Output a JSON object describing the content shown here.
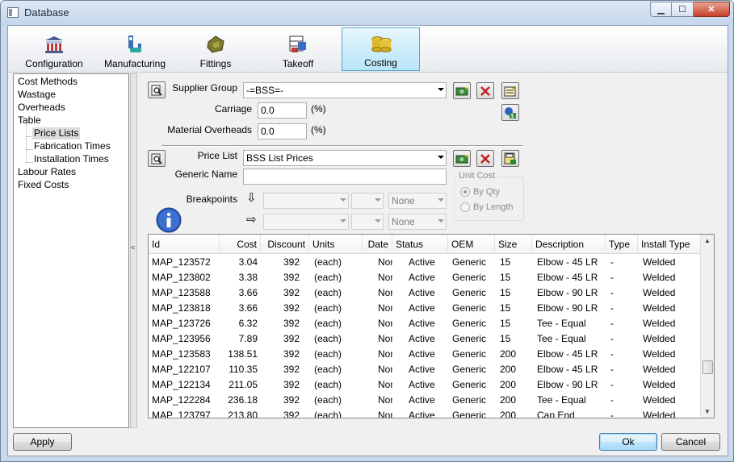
{
  "window": {
    "title": "Database"
  },
  "ribbon": {
    "tabs": [
      {
        "label": "Configuration",
        "icon": "configuration-icon"
      },
      {
        "label": "Manufacturing",
        "icon": "manufacturing-icon"
      },
      {
        "label": "Fittings",
        "icon": "fittings-icon"
      },
      {
        "label": "Takeoff",
        "icon": "takeoff-icon"
      },
      {
        "label": "Costing",
        "icon": "costing-icon",
        "active": true
      }
    ]
  },
  "tree": {
    "items": [
      {
        "label": "Cost Methods"
      },
      {
        "label": "Wastage"
      },
      {
        "label": "Overheads"
      },
      {
        "label": "Table"
      },
      {
        "label": "Price Lists",
        "selected": true
      },
      {
        "label": "Fabrication Times"
      },
      {
        "label": "Installation Times"
      },
      {
        "label": "Labour Rates"
      },
      {
        "label": "Fixed Costs"
      }
    ]
  },
  "supplier": {
    "group_label": "Supplier Group",
    "group_value": "-=BSS=-",
    "carriage_label": "Carriage",
    "carriage_value": "0.0",
    "carriage_unit": "(%)",
    "material_overheads_label": "Material Overheads",
    "material_overheads_value": "0.0",
    "material_overheads_unit": "(%)"
  },
  "pricelist": {
    "label": "Price List",
    "value": "BSS List Prices",
    "generic_name_label": "Generic Name",
    "generic_name_value": "",
    "breakpoints_label": "Breakpoints",
    "bp_none_1": "None",
    "bp_none_2": "None"
  },
  "unit_cost": {
    "title": "Unit Cost",
    "by_qty": "By Qty",
    "by_length": "By Length",
    "selected": "By Qty"
  },
  "table": {
    "columns": [
      "Id",
      "Cost",
      "Discount",
      "Units",
      "Date",
      "Status",
      "OEM",
      "Size",
      "Description",
      "Type",
      "Install Type"
    ],
    "rows": [
      [
        "MAP_123572",
        "3.04",
        "392",
        "(each)",
        "None",
        "Active",
        "Generic",
        "15",
        "Elbow - 45 LR",
        "-",
        "Welded"
      ],
      [
        "MAP_123802",
        "3.38",
        "392",
        "(each)",
        "None",
        "Active",
        "Generic",
        "15",
        "Elbow - 45 LR",
        "-",
        "Welded"
      ],
      [
        "MAP_123588",
        "3.66",
        "392",
        "(each)",
        "None",
        "Active",
        "Generic",
        "15",
        "Elbow - 90 LR",
        "-",
        "Welded"
      ],
      [
        "MAP_123818",
        "3.66",
        "392",
        "(each)",
        "None",
        "Active",
        "Generic",
        "15",
        "Elbow - 90 LR",
        "-",
        "Welded"
      ],
      [
        "MAP_123726",
        "6.32",
        "392",
        "(each)",
        "None",
        "Active",
        "Generic",
        "15",
        "Tee - Equal",
        "-",
        "Welded"
      ],
      [
        "MAP_123956",
        "7.89",
        "392",
        "(each)",
        "None",
        "Active",
        "Generic",
        "15",
        "Tee - Equal",
        "-",
        "Welded"
      ],
      [
        "MAP_123583",
        "138.51",
        "392",
        "(each)",
        "None",
        "Active",
        "Generic",
        "200",
        "Elbow - 45 LR",
        "-",
        "Welded"
      ],
      [
        "MAP_122107",
        "110.35",
        "392",
        "(each)",
        "None",
        "Active",
        "Generic",
        "200",
        "Elbow - 45 LR",
        "-",
        "Welded"
      ],
      [
        "MAP_122134",
        "211.05",
        "392",
        "(each)",
        "None",
        "Active",
        "Generic",
        "200",
        "Elbow - 90 LR",
        "-",
        "Welded"
      ],
      [
        "MAP_122284",
        "236.18",
        "392",
        "(each)",
        "None",
        "Active",
        "Generic",
        "200",
        "Tee - Equal",
        "-",
        "Welded"
      ],
      [
        "MAP_123797",
        "213.80",
        "392",
        "(each)",
        "None",
        "Active",
        "Generic",
        "200",
        "Cap End",
        "-",
        "Welded"
      ]
    ]
  },
  "footer": {
    "apply": "Apply",
    "ok": "Ok",
    "cancel": "Cancel"
  }
}
